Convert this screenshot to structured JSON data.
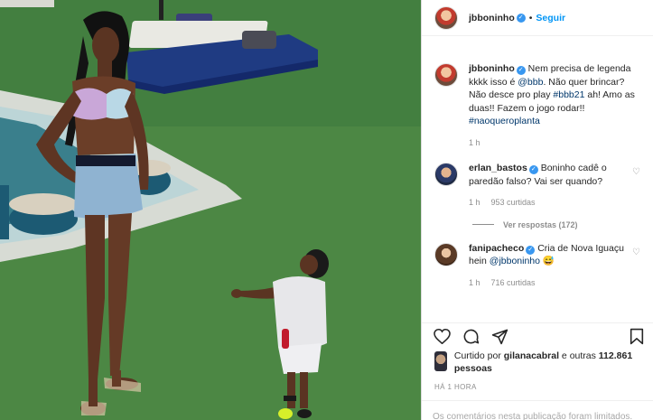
{
  "post": {
    "author": "jbboninho",
    "follow_label": "Seguir",
    "separator": "•",
    "caption": {
      "user": "jbboninho",
      "text_1": "Nem precisa de legenda kkkk isso é ",
      "mention_1": "@bbb",
      "text_2": ". Não quer brincar? Não desce pro play ",
      "hashtag_1": "#bbb21",
      "text_3": " ah! Amo as duas!! Fazem o jogo rodar!! ",
      "hashtag_2": "#naoqueroplanta",
      "time": "1 h"
    },
    "comments": [
      {
        "user": "erlan_bastos",
        "text": "Boninho cadê o paredão falso? Vai ser quando?",
        "time": "1 h",
        "likes": "953 curtidas",
        "replies": "Ver respostas (172)"
      },
      {
        "user": "fanipacheco",
        "text_1": "Cria de Nova Iguaçu hein ",
        "mention": "@jbboninho",
        "emoji": "😅",
        "time": "1 h",
        "likes": "716 curtidas"
      }
    ],
    "likes_line": {
      "prefix": "Curtido por ",
      "user": "gilanacabral",
      "middle": " e outras ",
      "count": "112.861 pessoas"
    },
    "timestamp": "HÁ 1 HORA",
    "footer_notice": "Os comentários nesta publicação foram limitados."
  },
  "icons": {
    "heart": "heart-icon",
    "comment": "comment-icon",
    "share": "send-icon",
    "save": "bookmark-icon",
    "verified": "verified-badge-icon"
  },
  "colors": {
    "link": "#0095f6",
    "tag": "#00376b",
    "muted": "#8e8e8e",
    "verified": "#3897f0"
  }
}
